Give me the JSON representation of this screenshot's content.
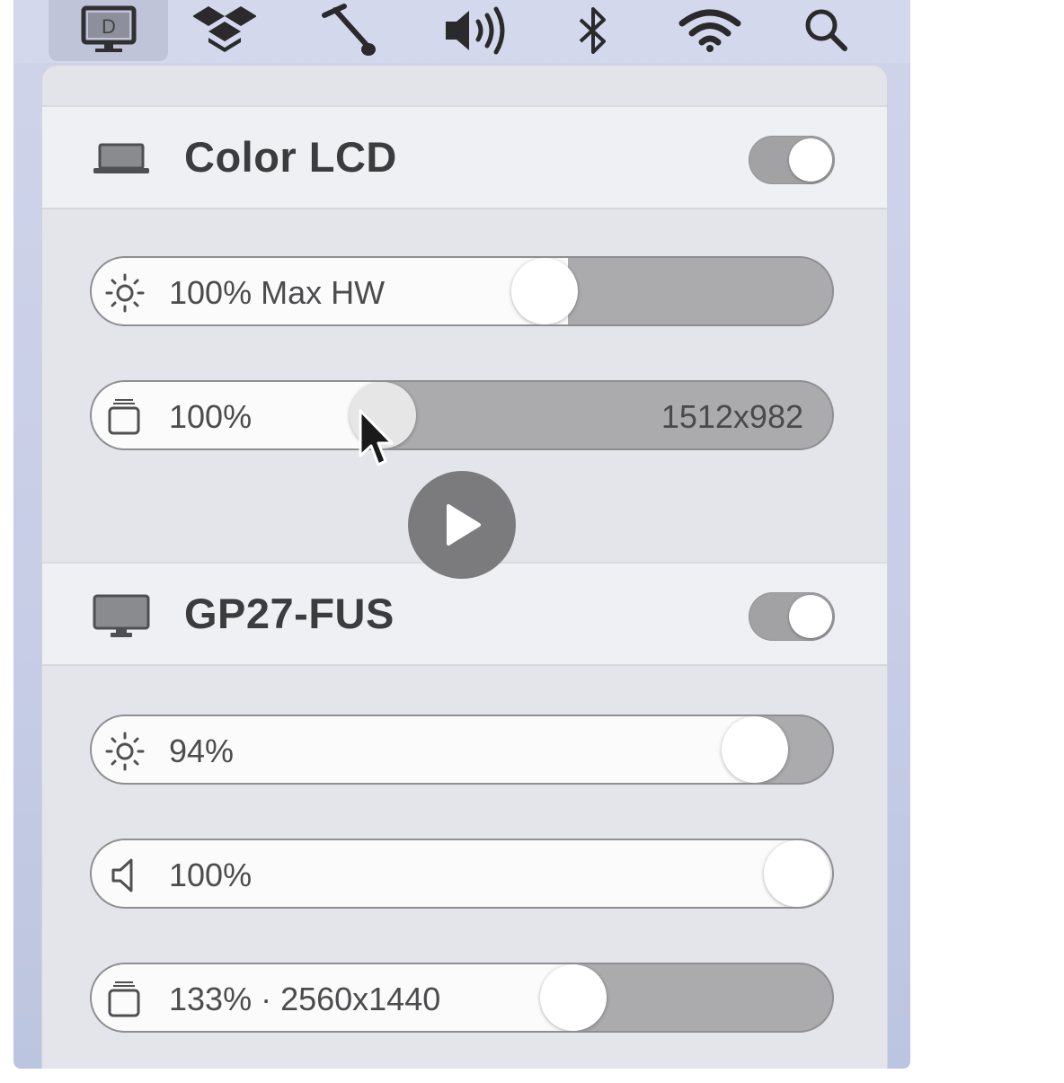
{
  "menubar": {
    "items": [
      {
        "name": "display-app-icon",
        "active": true
      },
      {
        "name": "dropbox-icon"
      },
      {
        "name": "tool-icon"
      },
      {
        "name": "volume-icon"
      },
      {
        "name": "bluetooth-icon"
      },
      {
        "name": "wifi-icon"
      },
      {
        "name": "search-icon"
      }
    ],
    "display_app_letter": "D"
  },
  "displays": [
    {
      "name": "Color LCD",
      "icon": "laptop-icon",
      "enabled": true,
      "brightness": {
        "label": "100% Max HW",
        "level": 0.62
      },
      "resolution": {
        "label": "100%",
        "right": "1512x982",
        "level": 0.39
      }
    },
    {
      "name": "GP27-FUS",
      "icon": "monitor-icon",
      "enabled": true,
      "brightness": {
        "label": "94%",
        "level": 0.9
      },
      "volume": {
        "label": "100%",
        "level": 1.0
      },
      "resolution": {
        "label": "133% · 2560x1440",
        "level": 0.66
      }
    }
  ],
  "colors": {
    "panel": "#e4e5ea",
    "header": "#eff0f3",
    "track": "#ababae",
    "fill": "#fbfbfb",
    "toggle_on": "#a2a2a5",
    "play_button": "#7b7b7e"
  }
}
